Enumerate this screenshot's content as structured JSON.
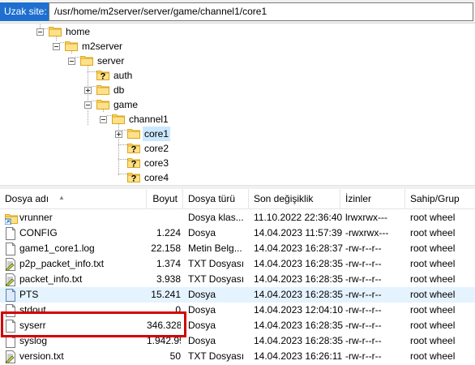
{
  "address_bar": {
    "label": "Uzak site:",
    "path": "/usr/home/m2server/server/game/channel1/core1"
  },
  "tree": {
    "nodes": [
      {
        "label": "home",
        "icon": "folder-icon",
        "expander": "minus",
        "selected": false
      },
      {
        "label": "m2server",
        "icon": "folder-icon",
        "expander": "minus",
        "selected": false
      },
      {
        "label": "server",
        "icon": "folder-icon",
        "expander": "minus",
        "selected": false
      },
      {
        "label": "auth",
        "icon": "folder-unknown-icon",
        "expander": "none",
        "selected": false
      },
      {
        "label": "db",
        "icon": "folder-icon",
        "expander": "plus",
        "selected": false
      },
      {
        "label": "game",
        "icon": "folder-icon",
        "expander": "minus",
        "selected": false
      },
      {
        "label": "channel1",
        "icon": "folder-icon",
        "expander": "minus",
        "selected": false
      },
      {
        "label": "core1",
        "icon": "folder-icon",
        "expander": "plus",
        "selected": true
      },
      {
        "label": "core2",
        "icon": "folder-unknown-icon",
        "expander": "none",
        "selected": false
      },
      {
        "label": "core3",
        "icon": "folder-unknown-icon",
        "expander": "none",
        "selected": false
      },
      {
        "label": "core4",
        "icon": "folder-unknown-icon",
        "expander": "none",
        "selected": false
      }
    ]
  },
  "table": {
    "columns": {
      "name": "Dosya adı",
      "size": "Boyut",
      "type": "Dosya türü",
      "modified": "Son değişiklik",
      "permissions": "İzinler",
      "owner": "Sahip/Grup"
    },
    "rows": [
      {
        "name": "vrunner",
        "icon": "symlink-folder-icon",
        "size": "",
        "type": "Dosya klas...",
        "modified": "11.10.2022 22:36:40",
        "permissions": "lrwxrwx---",
        "owner": "root wheel"
      },
      {
        "name": "CONFIG",
        "icon": "file-icon",
        "size": "1.224",
        "type": "Dosya",
        "modified": "14.04.2023 11:57:39",
        "permissions": "-rwxrwx---",
        "owner": "root wheel"
      },
      {
        "name": "game1_core1.log",
        "icon": "file-icon",
        "size": "22.158",
        "type": "Metin Belg...",
        "modified": "14.04.2023 16:28:37",
        "permissions": "-rw-r--r--",
        "owner": "root wheel"
      },
      {
        "name": "p2p_packet_info.txt",
        "icon": "text-file-icon",
        "size": "1.374",
        "type": "TXT Dosyası",
        "modified": "14.04.2023 16:28:35",
        "permissions": "-rw-r--r--",
        "owner": "root wheel"
      },
      {
        "name": "packet_info.txt",
        "icon": "text-file-icon",
        "size": "3.938",
        "type": "TXT Dosyası",
        "modified": "14.04.2023 16:28:35",
        "permissions": "-rw-r--r--",
        "owner": "root wheel"
      },
      {
        "name": "PTS",
        "icon": "file-blue-icon",
        "size": "15.241",
        "type": "Dosya",
        "modified": "14.04.2023 16:28:35",
        "permissions": "-rw-r--r--",
        "owner": "root wheel"
      },
      {
        "name": "stdout",
        "icon": "file-icon",
        "size": "0",
        "type": "Dosya",
        "modified": "14.04.2023 12:04:10",
        "permissions": "-rw-r--r--",
        "owner": "root wheel"
      },
      {
        "name": "syserr",
        "icon": "file-icon",
        "size": "346.328",
        "type": "Dosya",
        "modified": "14.04.2023 16:28:35",
        "permissions": "-rw-r--r--",
        "owner": "root wheel"
      },
      {
        "name": "syslog",
        "icon": "file-icon",
        "size": "1.942.993",
        "type": "Dosya",
        "modified": "14.04.2023 16:28:35",
        "permissions": "-rw-r--r--",
        "owner": "root wheel"
      },
      {
        "name": "version.txt",
        "icon": "text-file-icon",
        "size": "50",
        "type": "TXT Dosyası",
        "modified": "14.04.2023 16:26:11",
        "permissions": "-rw-r--r--",
        "owner": "root wheel"
      }
    ]
  },
  "colors": {
    "address_label_bg": "#1e6fcf",
    "selection": "#cce8ff",
    "row_highlight": "#e5f3ff",
    "annotation_box": "#d20000",
    "folder": "#ffd866"
  }
}
